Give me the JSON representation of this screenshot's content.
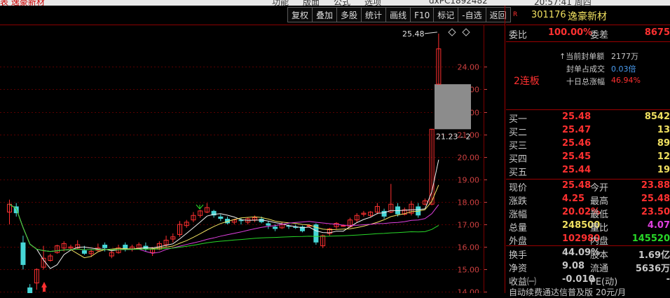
{
  "top_menu": {
    "left_text": "表 逸豪新材",
    "items": [
      "功能",
      "版面",
      "公式",
      "选项"
    ],
    "account": "dxPC1892482",
    "time": "20:57:41 周四"
  },
  "toolbar": [
    "复权",
    "叠加",
    "多股",
    "统计",
    "画线",
    "F10",
    "标记",
    "-自选",
    "返回"
  ],
  "chart_data": {
    "type": "candlestick",
    "y_ticks": [
      "24.00",
      "23.00",
      "22.00",
      "21.00",
      "20.00",
      "19.00",
      "18.00",
      "17.00",
      "16.00",
      "15.00",
      "14.00"
    ],
    "ylim": [
      13.95,
      25.85
    ],
    "candles": [
      [
        17.55,
        17.9,
        17.0,
        18.1
      ],
      [
        17.8,
        17.5,
        17.35,
        17.95
      ],
      [
        16.2,
        15.2,
        15.0,
        16.5
      ],
      [
        14.2,
        13.9,
        13.75,
        14.35
      ],
      [
        14.4,
        15.0,
        14.1,
        15.05
      ],
      [
        15.1,
        15.5,
        15.0,
        16.05
      ],
      [
        15.4,
        15.6,
        15.35,
        15.7
      ],
      [
        15.75,
        16.05,
        15.7,
        16.1
      ],
      [
        15.95,
        16.15,
        15.8,
        16.25
      ],
      [
        15.95,
        16.0,
        15.85,
        16.1
      ],
      [
        15.95,
        16.1,
        15.9,
        16.3
      ],
      [
        15.85,
        15.7,
        15.65,
        16.05
      ],
      [
        15.7,
        15.8,
        15.55,
        15.9
      ],
      [
        15.85,
        15.95,
        15.8,
        16.15
      ],
      [
        16.1,
        15.95,
        15.8,
        16.2
      ],
      [
        15.6,
        15.75,
        15.5,
        15.9
      ],
      [
        15.75,
        15.95,
        15.7,
        16.1
      ],
      [
        16.1,
        15.9,
        15.8,
        16.2
      ],
      [
        15.9,
        16.0,
        15.8,
        16.1
      ],
      [
        15.95,
        16.1,
        15.9,
        16.2
      ],
      [
        16.05,
        15.9,
        15.8,
        16.2
      ],
      [
        15.75,
        15.9,
        15.6,
        16.0
      ],
      [
        15.9,
        16.15,
        15.85,
        16.25
      ],
      [
        16.1,
        16.3,
        16.0,
        16.5
      ],
      [
        16.35,
        16.45,
        16.2,
        16.6
      ],
      [
        16.55,
        17.0,
        16.45,
        17.15
      ],
      [
        16.95,
        17.1,
        16.85,
        17.2
      ],
      [
        17.2,
        17.4,
        17.1,
        17.55
      ],
      [
        17.4,
        17.6,
        17.3,
        17.65
      ],
      [
        17.55,
        17.75,
        17.5,
        17.95
      ],
      [
        17.6,
        17.4,
        17.3,
        17.65
      ],
      [
        17.35,
        17.25,
        17.15,
        17.45
      ],
      [
        17.25,
        17.05,
        17.0,
        17.35
      ],
      [
        17.1,
        17.2,
        17.0,
        17.25
      ],
      [
        17.2,
        17.15,
        17.0,
        17.3
      ],
      [
        17.1,
        17.25,
        17.0,
        17.3
      ],
      [
        17.2,
        17.3,
        17.1,
        17.4
      ],
      [
        17.25,
        17.1,
        17.05,
        17.35
      ],
      [
        17.05,
        16.95,
        16.8,
        17.15
      ],
      [
        16.9,
        16.8,
        16.7,
        17.0
      ],
      [
        16.85,
        17.0,
        16.8,
        17.1
      ],
      [
        16.95,
        16.9,
        16.8,
        17.0
      ],
      [
        16.9,
        16.85,
        16.8,
        17.0
      ],
      [
        16.9,
        16.7,
        16.65,
        16.95
      ],
      [
        16.95,
        16.95,
        16.9,
        17.0
      ],
      [
        17.0,
        16.2,
        16.1,
        17.05
      ],
      [
        16.05,
        16.5,
        15.95,
        16.55
      ],
      [
        16.6,
        16.8,
        16.5,
        16.85
      ],
      [
        16.9,
        17.05,
        16.8,
        17.1
      ],
      [
        16.95,
        16.95,
        16.9,
        17.0
      ],
      [
        16.9,
        17.2,
        16.85,
        17.3
      ],
      [
        17.2,
        17.4,
        17.1,
        17.5
      ],
      [
        17.45,
        17.5,
        17.35,
        17.6
      ],
      [
        17.4,
        17.55,
        17.3,
        17.6
      ],
      [
        17.55,
        17.8,
        17.45,
        17.95
      ],
      [
        17.6,
        17.35,
        17.25,
        17.7
      ],
      [
        17.55,
        17.9,
        17.5,
        18.8
      ],
      [
        17.8,
        17.45,
        17.35,
        17.95
      ],
      [
        17.45,
        17.65,
        17.4,
        17.75
      ],
      [
        17.5,
        17.9,
        17.4,
        18.05
      ],
      [
        17.8,
        17.4,
        17.3,
        17.95
      ],
      [
        17.9,
        18.05,
        17.85,
        18.15
      ],
      [
        17.9,
        21.23,
        17.85,
        21.23
      ],
      [
        23.23,
        24.8,
        23.23,
        25.48
      ]
    ],
    "high_label": "25.48",
    "gap_label": "21.23 - 2",
    "colors": {
      "up": "#ff3030",
      "down": "#46d6d6",
      "ma5": "#f0f0f0",
      "ma10": "#f0e060",
      "ma20": "#e040e0",
      "ma60": "#28d828"
    }
  },
  "chart_annotations": {
    "streak": "2连板"
  },
  "quote": {
    "code": "301176",
    "name": "逸豪新材",
    "r_badge": "R",
    "webi_label": "委比",
    "webi_value": "100.00%",
    "weicha_label": "委差",
    "weicha_value": "8675",
    "seal": [
      {
        "label": "当前封单额",
        "value": "2177万",
        "color": "#c8c8c8"
      },
      {
        "label": "封单占成交",
        "value": "0.03倍",
        "color": "#4a9cf0"
      },
      {
        "label": "十日总涨幅",
        "value": "46.94%",
        "color": "#ff3030"
      }
    ],
    "bids": [
      {
        "label": "买一",
        "price": "25.48",
        "vol": "8542"
      },
      {
        "label": "买二",
        "price": "25.47",
        "vol": "13"
      },
      {
        "label": "买三",
        "price": "25.46",
        "vol": "89"
      },
      {
        "label": "买四",
        "price": "25.45",
        "vol": "12"
      },
      {
        "label": "买五",
        "price": "25.44",
        "vol": "19"
      }
    ],
    "stats": [
      {
        "l1": "现价",
        "v1": "25.48",
        "c1": "#ff3030",
        "l2": "今开",
        "v2": "23.88",
        "c2": "#ff3030"
      },
      {
        "l1": "涨跌",
        "v1": "4.25",
        "c1": "#ff3030",
        "l2": "最高",
        "v2": "25.48",
        "c2": "#ff3030"
      },
      {
        "l1": "涨幅",
        "v1": "20.02%",
        "c1": "#ff3030",
        "l2": "最低",
        "v2": "23.50",
        "c2": "#ff3030"
      },
      {
        "l1": "总量",
        "v1": "248500",
        "c1": "#f0e060",
        "l2": "量比",
        "v2": "4.07",
        "c2": "#e040e0"
      },
      {
        "l1": "外盘",
        "v1": "102980",
        "c1": "#ff3030",
        "l2": "内盘",
        "v2": "145520",
        "c2": "#28d828"
      },
      {
        "l1": "换手",
        "v1": "44.09%",
        "c1": "#c8c8c8",
        "l2": "股本",
        "v2": "1.69亿",
        "c2": "#c8c8c8"
      },
      {
        "l1": "净资",
        "v1": "9.08",
        "c1": "#c8c8c8",
        "l2": "流通",
        "v2": "5636万",
        "c2": "#c8c8c8"
      },
      {
        "l1": "收益㈠",
        "v1": "-0.010",
        "c1": "#c8c8c8",
        "l2": "PE(动)",
        "v2": "-",
        "c2": "#c8c8c8"
      }
    ],
    "bottom_text": "自动续费通达信普及版 20元/月"
  }
}
